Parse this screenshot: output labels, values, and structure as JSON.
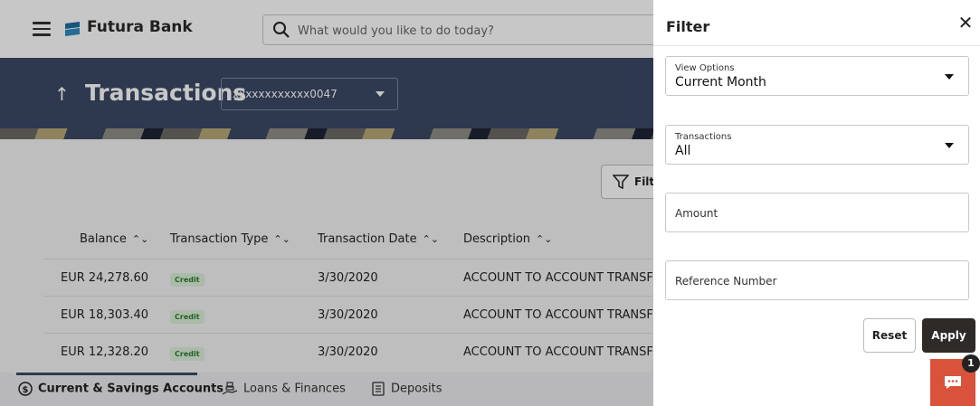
{
  "app": {
    "brand": "Futura Bank"
  },
  "search": {
    "placeholder": "What would you like to do today?"
  },
  "banner": {
    "title": "Transactions",
    "account": "xxxxxxxxxxxx0047"
  },
  "toolbar": {
    "filter_label": "Filte"
  },
  "table": {
    "columns": [
      "Balance",
      "Transaction Type",
      "Transaction Date",
      "Description"
    ],
    "rows": [
      {
        "balance": "EUR 24,278.60",
        "type": "Credit",
        "date": "3/30/2020",
        "description": "ACCOUNT TO ACCOUNT TRANSFE"
      },
      {
        "balance": "EUR 18,303.40",
        "type": "Credit",
        "date": "3/30/2020",
        "description": "ACCOUNT TO ACCOUNT TRANSFE"
      },
      {
        "balance": "EUR 12,328.20",
        "type": "Credit",
        "date": "3/30/2020",
        "description": "ACCOUNT TO ACCOUNT TRANSFE"
      }
    ]
  },
  "bottom_tabs": [
    {
      "label": "Current & Savings Accounts",
      "icon": "dollar-circle-icon"
    },
    {
      "label": "Loans & Finances",
      "icon": "money-hand-icon"
    },
    {
      "label": "Deposits",
      "icon": "deposit-book-icon"
    }
  ],
  "filter_panel": {
    "title": "Filter",
    "view_options": {
      "label": "View Options",
      "value": "Current Month"
    },
    "transactions": {
      "label": "Transactions",
      "value": "All"
    },
    "amount": {
      "placeholder": "Amount"
    },
    "reference": {
      "placeholder": "Reference Number"
    },
    "reset_label": "Reset",
    "apply_label": "Apply"
  },
  "chat": {
    "badge": "1"
  },
  "colors": {
    "banner": "#3c4a66",
    "apply": "#2d2a28",
    "chat": "#d9533c",
    "credit_badge": "#dcefd9"
  }
}
